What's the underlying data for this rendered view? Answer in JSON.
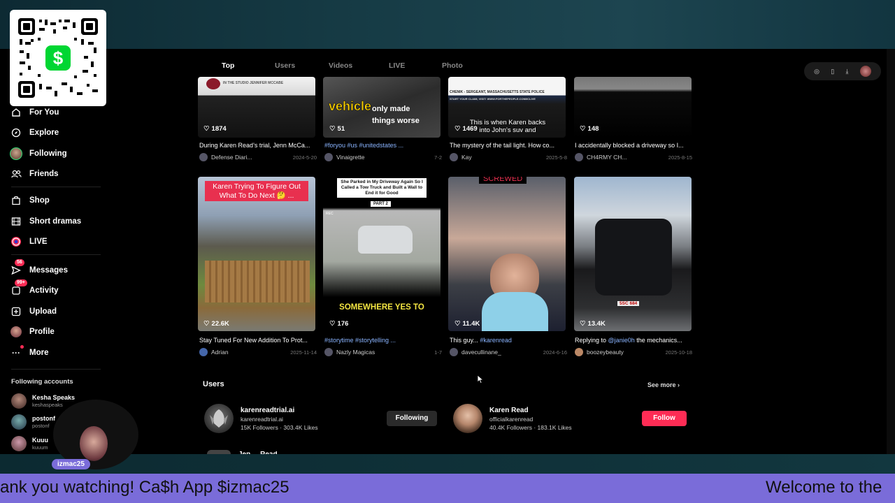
{
  "tabs": [
    {
      "label": "Top",
      "active": true
    },
    {
      "label": "Users",
      "active": false
    },
    {
      "label": "Videos",
      "active": false
    },
    {
      "label": "LIVE",
      "active": false
    },
    {
      "label": "Photo",
      "active": false
    }
  ],
  "sidebar": {
    "items": [
      {
        "label": "For You",
        "icon": "home-icon"
      },
      {
        "label": "Explore",
        "icon": "compass-icon"
      },
      {
        "label": "Following",
        "icon": "following-avatar-icon"
      },
      {
        "label": "Friends",
        "icon": "friends-icon"
      },
      {
        "label": "Shop",
        "icon": "shopping-bag-icon"
      },
      {
        "label": "Short dramas",
        "icon": "film-icon"
      },
      {
        "label": "LIVE",
        "icon": "live-icon"
      },
      {
        "label": "Messages",
        "icon": "message-icon",
        "badge": "56"
      },
      {
        "label": "Activity",
        "icon": "activity-icon",
        "badge": "99+"
      },
      {
        "label": "Upload",
        "icon": "upload-icon"
      },
      {
        "label": "Profile",
        "icon": "profile-avatar-icon"
      },
      {
        "label": "More",
        "icon": "more-icon"
      }
    ],
    "following_title": "Following accounts",
    "following": [
      {
        "name": "Kesha Speaks",
        "handle": "keshaspeaks"
      },
      {
        "name": "postonf",
        "handle": "postonf"
      },
      {
        "name": "Kuuu",
        "handle": "kuuum"
      }
    ]
  },
  "videos_row1": [
    {
      "likes": "1874",
      "caption": "During Karen Read’s trial, Jenn McCa...",
      "author": "Defense Diari...",
      "date": "2024-5-20",
      "overlay": "IN THE STUDIO JENNIFER MCCABE"
    },
    {
      "likes": "51",
      "caption_tags": "#foryou #us #unitedstates ...",
      "author": "Vinaigrette",
      "date": "7-2",
      "overlay_a": "vehicle",
      "overlay_b": "only made things worse"
    },
    {
      "likes": "1469",
      "caption": "The mystery of the tail light. How co...",
      "author": "Kay",
      "date": "2025-5-8",
      "overlay_top": "CHENIK - SERGEANT, MASSACHUSETTS STATE POLICE",
      "overlay_sub": "START YOUR CLAIM, VISIT: WWW.FORTHEPEOPLE.COM/ICLIVE",
      "overlay": "This is when Karen backs into John's suv and"
    },
    {
      "likes": "148",
      "caption": "I accidentally blocked a driveway so I...",
      "author": "CH4RMY CH...",
      "date": "2025-8-15"
    }
  ],
  "videos_row2": [
    {
      "likes": "22.6K",
      "caption": "Stay Tuned For New Addition To Prot...",
      "author": "Adrian",
      "date": "2025-11-14",
      "overlay": "Karen Trying To Figure Out What To Do Next 🤔 ..."
    },
    {
      "likes": "176",
      "caption_tags": "#storytime #storytelling ...",
      "author": "Nazly Magicas",
      "date": "1-7",
      "overlay": "She Parked in My Driveway Again So I Called a Tow Truck and Built a Wall to End it for Good",
      "overlay_part": "PART 2",
      "overlay_rec": "REC",
      "overlay_bottom": "SOMEWHERE YES TO"
    },
    {
      "likes": "11.4K",
      "caption": "This guy...",
      "caption_tag": "#karenread",
      "author": "davecullinane_",
      "date": "2024-6-16",
      "overlay": "SCREWED"
    },
    {
      "likes": "13.4K",
      "caption": "Replying to",
      "caption_tag": "@janie0h",
      "caption_rest": " the mechanics...",
      "author": "boozeybeauty",
      "date": "2025-10-18",
      "overlay": "5SC 684"
    }
  ],
  "users": {
    "title": "Users",
    "see_more": "See more",
    "list": [
      {
        "name": "karenreadtrial.ai",
        "handle": "karenreadtrial.ai",
        "followers": "15K Followers",
        "likes": "303.4K Likes",
        "button": "Following"
      },
      {
        "name": "Karen Read",
        "handle": "officialkarenread",
        "followers": "40.4K Followers",
        "likes": "183.1K Likes",
        "button": "Follow"
      }
    ],
    "partial_name": "Jen ... Read"
  },
  "stream": {
    "ticker_left": "ank you watching! Ca$h App $izmac25",
    "ticker_right": "Welcome to the",
    "cam_label": "izmac25",
    "qr_symbol": "$"
  },
  "colors": {
    "accent": "#fe2c55",
    "ticker": "#7a6cd9",
    "cashapp": "#00d632"
  }
}
